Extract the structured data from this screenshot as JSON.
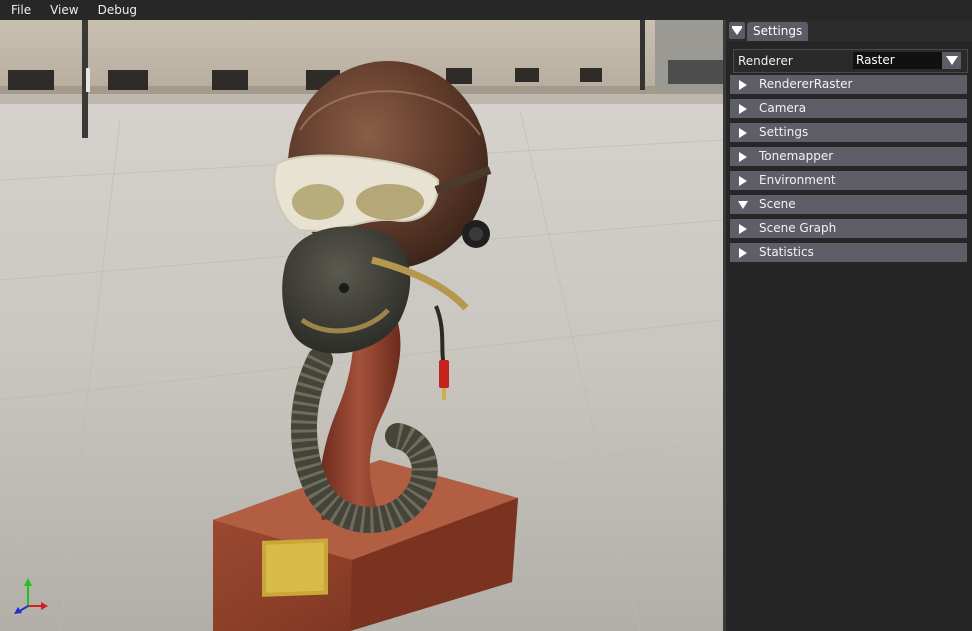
{
  "menu": [
    "File",
    "View",
    "Debug"
  ],
  "panel": {
    "tab_title": "Settings",
    "renderer_label": "Renderer",
    "renderer_value": "Raster",
    "sections": [
      {
        "label": "RendererRaster",
        "expanded": false
      },
      {
        "label": "Camera",
        "expanded": false
      },
      {
        "label": "Settings",
        "expanded": false
      },
      {
        "label": "Tonemapper",
        "expanded": false
      },
      {
        "label": "Environment",
        "expanded": false
      },
      {
        "label": "Scene",
        "expanded": true
      },
      {
        "label": "Scene Graph",
        "expanded": false
      },
      {
        "label": "Statistics",
        "expanded": false
      }
    ]
  },
  "colors": {
    "panel_bg": "#262626",
    "header_bg": "#5e5e69",
    "menubar_bg": "#272727"
  }
}
